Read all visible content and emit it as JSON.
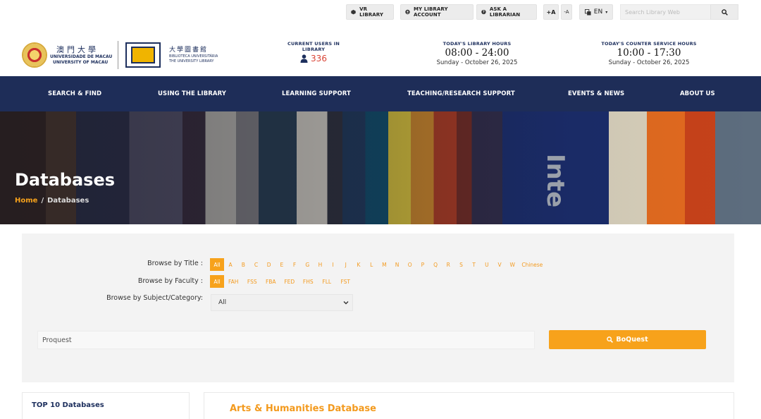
{
  "utility": {
    "vr_library": "VR LIBRARY",
    "my_account": "MY LIBRARY ACCOUNT",
    "ask_librarian": "ASK A LIBRARIAN",
    "font_increase": "+A",
    "font_decrease": "-A",
    "language": "EN",
    "search_placeholder": "Search Library Web"
  },
  "header": {
    "um_cn": "澳門大學",
    "um_pt": "UNIVERSIDADE DE MACAU",
    "um_en": "UNIVERSITY OF MACAU",
    "lib_cn": "大學圖書館",
    "lib_pt": "BIBLIOTECA UNIVERSITÁRIA",
    "lib_en": "THE UNIVERSITY LIBRARY",
    "users_label": "CURRENT USERS IN LIBRARY",
    "users_count": "336",
    "hours_label": "TODAY'S LIBRARY HOURS",
    "hours_value": "08:00 - 24:00",
    "hours_date": "Sunday - October 26, 2025",
    "counter_label": "TODAY'S COUNTER SERVICE HOURS",
    "counter_value": "10:00 - 17:30",
    "counter_date": "Sunday - October 26, 2025"
  },
  "nav": [
    "SEARCH & FIND",
    "USING THE LIBRARY",
    "LEARNING SUPPORT",
    "TEACHING/RESEARCH SUPPORT",
    "EVENTS & NEWS",
    "ABOUT US"
  ],
  "hero": {
    "title": "Databases",
    "breadcrumb_home": "Home",
    "breadcrumb_sep": "/",
    "breadcrumb_current": "Databases",
    "book_text": "Inte"
  },
  "filters": {
    "title_label": "Browse by Title :",
    "title_letters": [
      "All",
      "A",
      "B",
      "C",
      "D",
      "E",
      "F",
      "G",
      "H",
      "I",
      "J",
      "K",
      "L",
      "M",
      "N",
      "O",
      "P",
      "Q",
      "R",
      "S",
      "T",
      "U",
      "V",
      "W",
      "Chinese"
    ],
    "faculty_label": "Browse by Faculty :",
    "faculties": [
      "All",
      "FAH",
      "FSS",
      "FBA",
      "FED",
      "FHS",
      "FLL",
      "FST"
    ],
    "subject_label": "Browse by Subject/Category:",
    "subject_value": "All",
    "search_value": "Proquest",
    "search_button": "BoQuest"
  },
  "sidebar": {
    "top10_title": "TOP 10 Databases"
  },
  "content": {
    "section_title": "Arts & Humanities Database"
  },
  "colors": {
    "navy": "#1e2d58",
    "accent": "#f7a21b",
    "count_red": "#d94436"
  }
}
